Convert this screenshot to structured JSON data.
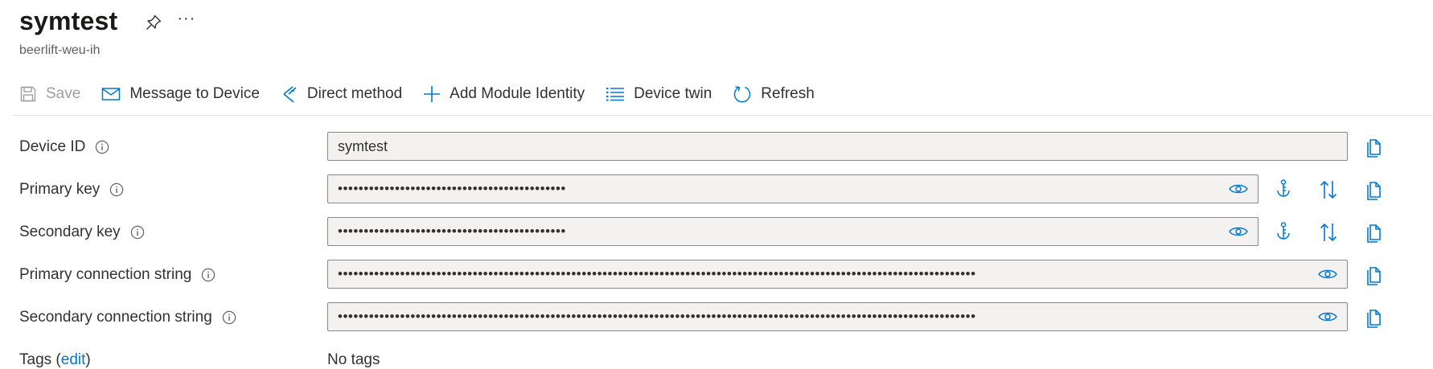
{
  "header": {
    "title": "symtest",
    "subtitle": "beerlift-weu-ih",
    "more_label": "···"
  },
  "toolbar": {
    "save": "Save",
    "message": "Message to Device",
    "direct_method": "Direct method",
    "add_module": "Add Module Identity",
    "device_twin": "Device twin",
    "refresh": "Refresh"
  },
  "fields": {
    "device_id": {
      "label": "Device ID",
      "value": "symtest"
    },
    "primary_key": {
      "label": "Primary key",
      "value": "••••••••••••••••••••••••••••••••••••••••••••"
    },
    "secondary_key": {
      "label": "Secondary key",
      "value": "••••••••••••••••••••••••••••••••••••••••••••"
    },
    "primary_conn": {
      "label": "Primary connection string",
      "value": "•••••••••••••••••••••••••••••••••••••••••••••••••••••••••••••••••••••••••••••••••••••••••••••••••••••••••••••••••••••••••••"
    },
    "secondary_conn": {
      "label": "Secondary connection string",
      "value": "•••••••••••••••••••••••••••••••••••••••••••••••••••••••••••••••••••••••••••••••••••••••••••••••••••••••••••••••••••••••••••"
    }
  },
  "tags": {
    "label": "Tags",
    "open_paren": " (",
    "edit_link": "edit",
    "close_paren": ")",
    "value": "No tags"
  },
  "colors": {
    "accent": "#0078d4",
    "field_bg": "#f3f2f1",
    "border": "#8a8886"
  }
}
